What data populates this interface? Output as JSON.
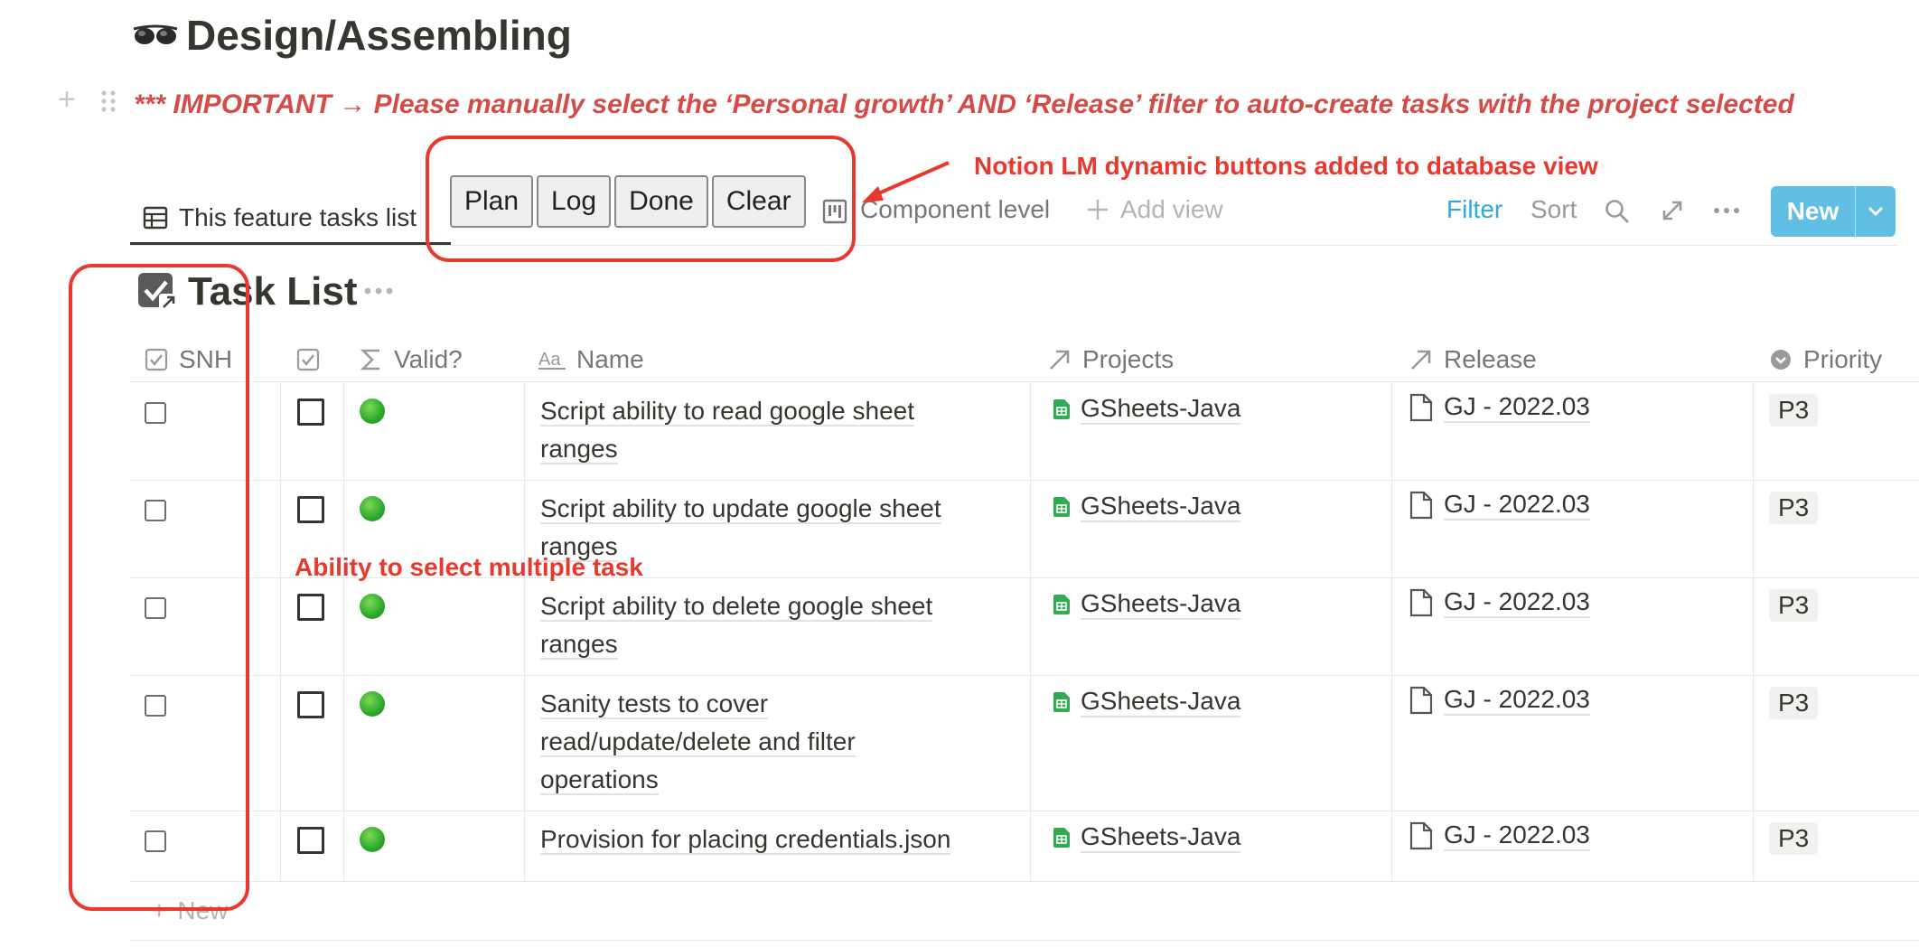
{
  "page": {
    "title": "Design/Assembling",
    "notice": "*** IMPORTANT → Please manually select the ‘Personal growth’ AND ‘Release’ filter to auto-create tasks with the project selected"
  },
  "views": {
    "active_tab": "This feature tasks list",
    "buttons": [
      "Plan",
      "Log",
      "Done",
      "Clear"
    ],
    "second_tab": "Component level",
    "add_view": "Add view",
    "filter": "Filter",
    "sort": "Sort",
    "new": "New"
  },
  "annotations": {
    "buttons_note": "Notion LM dynamic buttons added to database view",
    "select_note": "Ability to select multiple task",
    "color": "#e8392f"
  },
  "database": {
    "title": "Task List",
    "columns": {
      "snh": "SNH",
      "valid": "Valid?",
      "name": "Name",
      "projects": "Projects",
      "release": "Release",
      "priority": "Priority"
    },
    "rows": [
      {
        "name": "Script ability to read google sheet ranges",
        "project": "GSheets-Java",
        "release": "GJ - 2022.03",
        "priority": "P3",
        "valid": "green"
      },
      {
        "name": "Script ability to update google sheet ranges",
        "project": "GSheets-Java",
        "release": "GJ - 2022.03",
        "priority": "P3",
        "valid": "green"
      },
      {
        "name": "Script ability to delete google sheet ranges",
        "project": "GSheets-Java",
        "release": "GJ - 2022.03",
        "priority": "P3",
        "valid": "green"
      },
      {
        "name": "Sanity tests to cover read/update/delete and filter operations",
        "project": "GSheets-Java",
        "release": "GJ - 2022.03",
        "priority": "P3",
        "valid": "green"
      },
      {
        "name": "Provision for placing credentials.json",
        "project": "GSheets-Java",
        "release": "GJ - 2022.03",
        "priority": "P3",
        "valid": "green"
      }
    ],
    "new_row": "New"
  },
  "colors": {
    "accent": "#2eaadc",
    "notice_red": "#d44c47",
    "valid_green": "#2ba82b"
  }
}
